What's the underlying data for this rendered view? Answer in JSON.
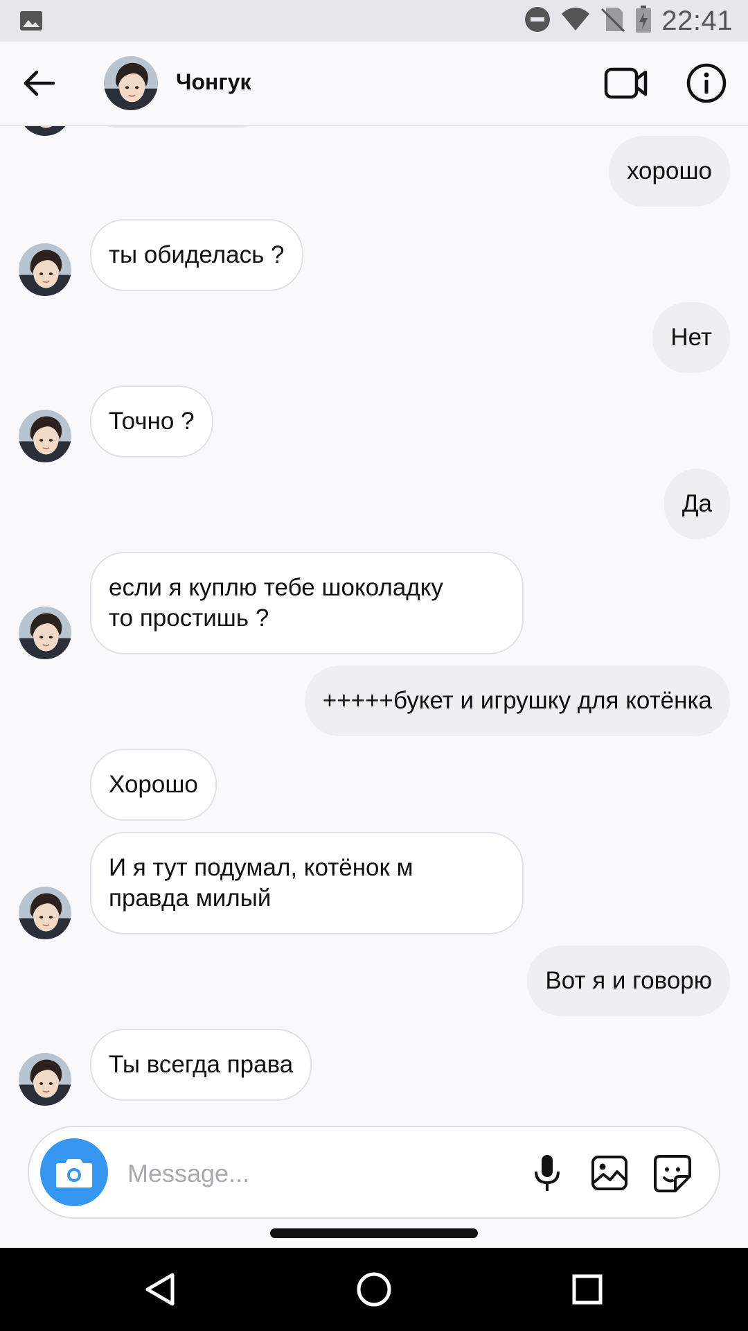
{
  "status_bar": {
    "time": "22:41",
    "icons": [
      "gallery-icon",
      "dnd-icon",
      "wifi-icon",
      "no-sim-icon",
      "battery-icon"
    ]
  },
  "header": {
    "contact_name": "Чонгук",
    "icons": [
      "back-arrow-icon",
      "video-call-icon",
      "info-icon"
    ]
  },
  "messages": [
    {
      "direction": "out",
      "text": "хорошо"
    },
    {
      "direction": "in",
      "text": "ты обиделась ?",
      "show_avatar": true
    },
    {
      "direction": "out",
      "text": "Нет"
    },
    {
      "direction": "in",
      "text": "Точно ?",
      "show_avatar": true
    },
    {
      "direction": "out",
      "text": "Да"
    },
    {
      "direction": "in",
      "text": "если я куплю тебе шоколадку\nто простишь ?",
      "show_avatar": true
    },
    {
      "direction": "out",
      "text": "+++++букет и игрушку для котёнка"
    },
    {
      "direction": "in",
      "text": "Хорошо",
      "show_avatar": false
    },
    {
      "direction": "in",
      "text": "И я тут подумал, котёнок м\nправда милый",
      "show_avatar": true
    },
    {
      "direction": "out",
      "text": "Вот я и говорю"
    },
    {
      "direction": "in",
      "text": "Ты всегда права",
      "show_avatar": true
    }
  ],
  "composer": {
    "placeholder": "Message...",
    "icons": [
      "camera-icon",
      "microphone-icon",
      "gallery-icon",
      "sticker-icon"
    ]
  },
  "colors": {
    "accent": "#3797f0",
    "background": "#f9f8fb",
    "outgoing_bubble": "#efeef1",
    "incoming_bubble": "#ffffff"
  }
}
